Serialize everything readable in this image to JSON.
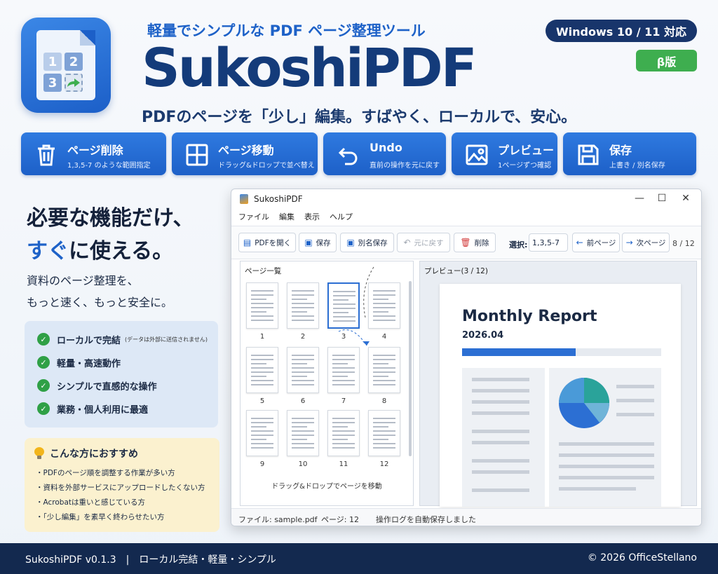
{
  "header": {
    "tagline": "軽量でシンプルな PDF ページ整理ツール",
    "brand": "SukoshiPDF",
    "subtitle": "PDFのページを「少し」編集。すばやく、ローカルで、安心。",
    "os_badge": "Windows 10 / 11 対応",
    "beta_badge": "β版",
    "icon_numbers": [
      "1",
      "2",
      "3"
    ]
  },
  "features": [
    {
      "icon": "trash-icon",
      "title": "ページ削除",
      "desc": "1,3,5-7 のような範囲指定"
    },
    {
      "icon": "grid-icon",
      "title": "ページ移動",
      "desc": "ドラッグ&ドロップで並べ替え"
    },
    {
      "icon": "undo-icon",
      "title": "Undo",
      "desc": "直前の操作を元に戻す"
    },
    {
      "icon": "image-icon",
      "title": "プレビュー",
      "desc": "1ページずつ確認"
    },
    {
      "icon": "save-icon",
      "title": "保存",
      "desc": "上書き / 別名保存"
    }
  ],
  "hero": {
    "line1": "必要な機能だけ、",
    "line2_accent": "すぐ",
    "line2_rest": "に使える。",
    "lead1": "資料のページ整理を、",
    "lead2": "もっと速く、もっと安全に。"
  },
  "checks": [
    {
      "label": "ローカルで完結",
      "note": "(データは外部に送信されません)"
    },
    {
      "label": "軽量・高速動作",
      "note": ""
    },
    {
      "label": "シンプルで直感的な操作",
      "note": ""
    },
    {
      "label": "業務・個人利用に最適",
      "note": ""
    }
  ],
  "recommend": {
    "title": "こんな方におすすめ",
    "items": [
      "・PDFのページ順を調整する作業が多い方",
      "・資料を外部サービスにアップロードしたくない方",
      "・Acrobatは重いと感じている方",
      "・「少し編集」を素早く終わらせたい方"
    ]
  },
  "window": {
    "title": "SukoshiPDF",
    "controls": [
      "—",
      "☐",
      "✕"
    ],
    "menu": [
      "ファイル",
      "編集",
      "表示",
      "ヘルプ"
    ],
    "toolbar": {
      "open": "PDFを開く",
      "save": "保存",
      "save_as": "別名保存",
      "undo": "元に戻す",
      "delete": "削除",
      "select_label": "選択:",
      "select_value": "1,3,5-7",
      "prev": "前ページ",
      "next": "次ページ",
      "page_count": "8 / 12"
    },
    "thumbs_title": "ページ一覧",
    "thumb_numbers": [
      "1",
      "2",
      "3",
      "4",
      "5",
      "6",
      "7",
      "8",
      "9",
      "10",
      "11",
      "12"
    ],
    "selected_thumb": "3",
    "dnd_hint": "ドラッグ&ドロップでページを移動",
    "preview_title": "プレビュー(3 / 12)",
    "preview": {
      "report_title": "Monthly Report",
      "report_date": "2026.04",
      "progress": 0.57
    },
    "status": {
      "file": "ファイル: sample.pdf",
      "page": "ページ: 12",
      "message": "操作ログを自動保存しました"
    }
  },
  "footer": {
    "version": "SukoshiPDF v0.1.3　|　ローカル完結・軽量・シンプル",
    "copyright": "© 2026 OfficeStellano"
  },
  "colors": {
    "accent": "#1e62c8",
    "brand": "#143b7a",
    "success": "#2fa046",
    "beta": "#3eae4f",
    "footer": "#13294f"
  }
}
